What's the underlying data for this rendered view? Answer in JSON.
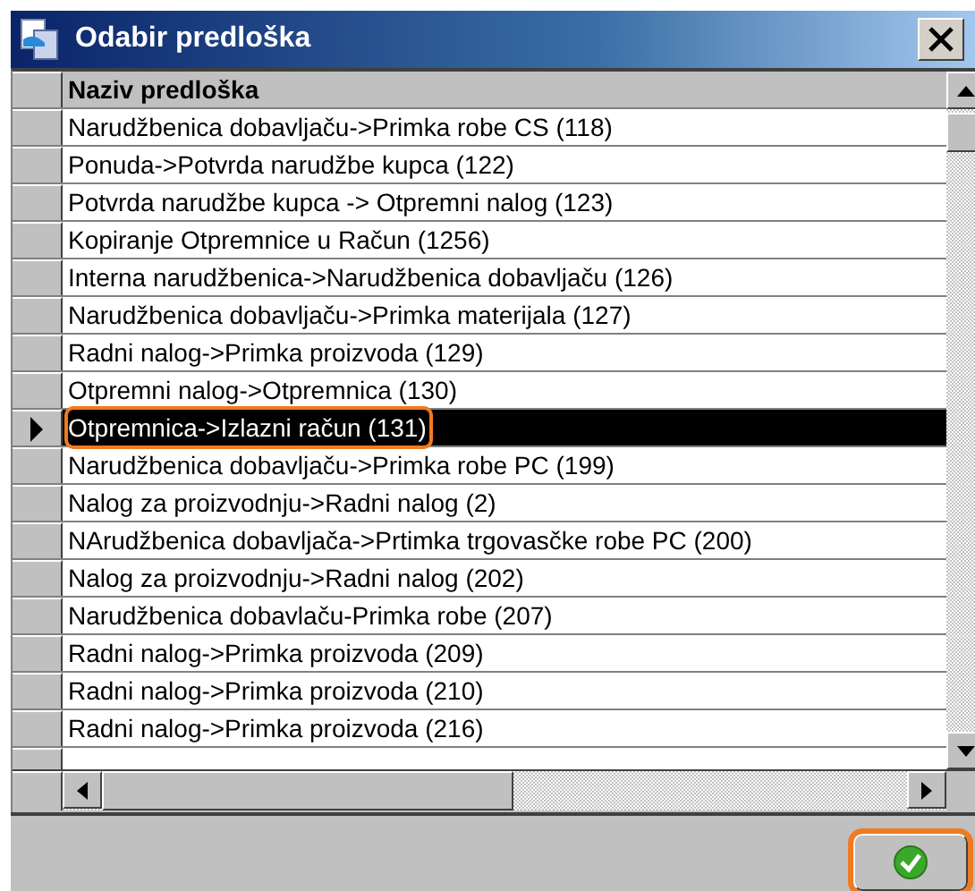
{
  "window": {
    "title": "Odabir predloška"
  },
  "table": {
    "columns": [
      "Naziv predloška"
    ],
    "rows": [
      {
        "name": "Narudžbenica dobavljaču->Primka robe CS (118)",
        "selected": false,
        "highlighted": false
      },
      {
        "name": "Ponuda->Potvrda narudžbe kupca (122)",
        "selected": false,
        "highlighted": false
      },
      {
        "name": "Potvrda narudžbe kupca -> Otpremni nalog (123)",
        "selected": false,
        "highlighted": false
      },
      {
        "name": "Kopiranje Otpremnice u Račun (1256)",
        "selected": false,
        "highlighted": false
      },
      {
        "name": "Interna narudžbenica->Narudžbenica dobavljaču (126)",
        "selected": false,
        "highlighted": false
      },
      {
        "name": "Narudžbenica dobavljaču->Primka materijala (127)",
        "selected": false,
        "highlighted": false
      },
      {
        "name": "Radni nalog->Primka proizvoda (129)",
        "selected": false,
        "highlighted": false
      },
      {
        "name": "Otpremni nalog->Otpremnica (130)",
        "selected": false,
        "highlighted": false
      },
      {
        "name": "Otpremnica->Izlazni račun (131)",
        "selected": true,
        "highlighted": true
      },
      {
        "name": "Narudžbenica dobavljaču->Primka robe PC (199)",
        "selected": false,
        "highlighted": false
      },
      {
        "name": "Nalog za proizvodnju->Radni nalog (2)",
        "selected": false,
        "highlighted": false
      },
      {
        "name": "NArudžbenica dobavljača->Prtimka trgovasčke robe PC (200)",
        "selected": false,
        "highlighted": false
      },
      {
        "name": "Nalog za proizvodnju->Radni nalog (202)",
        "selected": false,
        "highlighted": false
      },
      {
        "name": "Narudžbenica dobavlaču-Primka robe (207)",
        "selected": false,
        "highlighted": false
      },
      {
        "name": "Radni nalog->Primka proizvoda (209)",
        "selected": false,
        "highlighted": false
      },
      {
        "name": "Radni nalog->Primka proizvoda (210)",
        "selected": false,
        "highlighted": false
      },
      {
        "name": "Radni nalog->Primka proizvoda (216)",
        "selected": false,
        "highlighted": false
      }
    ]
  },
  "ok_button": {
    "highlighted": true
  }
}
